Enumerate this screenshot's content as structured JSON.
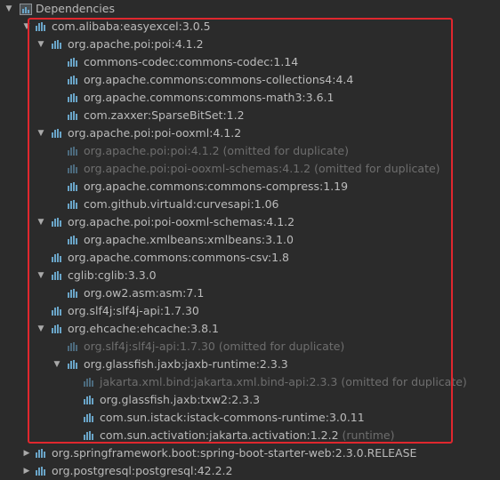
{
  "root": {
    "label": "Dependencies"
  },
  "colors": {
    "highlight": "#e0272e",
    "icon": "#6aa5c8",
    "text": "#bbbbbb",
    "dim": "#6e6e6e"
  },
  "tree": [
    {
      "label": "com.alibaba:easyexcel:3.0.5",
      "suffix": "",
      "level": 1,
      "expand": "open",
      "dim": false
    },
    {
      "label": "org.apache.poi:poi:4.1.2",
      "suffix": "",
      "level": 2,
      "expand": "open",
      "dim": false
    },
    {
      "label": "commons-codec:commons-codec:1.14",
      "suffix": "",
      "level": 3,
      "expand": "none",
      "dim": false
    },
    {
      "label": "org.apache.commons:commons-collections4:4.4",
      "suffix": "",
      "level": 3,
      "expand": "none",
      "dim": false
    },
    {
      "label": "org.apache.commons:commons-math3:3.6.1",
      "suffix": "",
      "level": 3,
      "expand": "none",
      "dim": false
    },
    {
      "label": "com.zaxxer:SparseBitSet:1.2",
      "suffix": "",
      "level": 3,
      "expand": "none",
      "dim": false
    },
    {
      "label": "org.apache.poi:poi-ooxml:4.1.2",
      "suffix": "",
      "level": 2,
      "expand": "open",
      "dim": false
    },
    {
      "label": "org.apache.poi:poi:4.1.2",
      "suffix": " (omitted for duplicate)",
      "level": 3,
      "expand": "none",
      "dim": true
    },
    {
      "label": "org.apache.poi:poi-ooxml-schemas:4.1.2",
      "suffix": " (omitted for duplicate)",
      "level": 3,
      "expand": "none",
      "dim": true
    },
    {
      "label": "org.apache.commons:commons-compress:1.19",
      "suffix": "",
      "level": 3,
      "expand": "none",
      "dim": false
    },
    {
      "label": "com.github.virtuald:curvesapi:1.06",
      "suffix": "",
      "level": 3,
      "expand": "none",
      "dim": false
    },
    {
      "label": "org.apache.poi:poi-ooxml-schemas:4.1.2",
      "suffix": "",
      "level": 2,
      "expand": "open",
      "dim": false
    },
    {
      "label": "org.apache.xmlbeans:xmlbeans:3.1.0",
      "suffix": "",
      "level": 3,
      "expand": "none",
      "dim": false
    },
    {
      "label": "org.apache.commons:commons-csv:1.8",
      "suffix": "",
      "level": 2,
      "expand": "none",
      "dim": false
    },
    {
      "label": "cglib:cglib:3.3.0",
      "suffix": "",
      "level": 2,
      "expand": "open",
      "dim": false
    },
    {
      "label": "org.ow2.asm:asm:7.1",
      "suffix": "",
      "level": 3,
      "expand": "none",
      "dim": false
    },
    {
      "label": "org.slf4j:slf4j-api:1.7.30",
      "suffix": "",
      "level": 2,
      "expand": "none",
      "dim": false
    },
    {
      "label": "org.ehcache:ehcache:3.8.1",
      "suffix": "",
      "level": 2,
      "expand": "open",
      "dim": false
    },
    {
      "label": "org.slf4j:slf4j-api:1.7.30",
      "suffix": " (omitted for duplicate)",
      "level": 3,
      "expand": "none",
      "dim": true
    },
    {
      "label": "org.glassfish.jaxb:jaxb-runtime:2.3.3",
      "suffix": "",
      "level": 3,
      "expand": "open",
      "dim": false
    },
    {
      "label": "jakarta.xml.bind:jakarta.xml.bind-api:2.3.3",
      "suffix": " (omitted for duplicate)",
      "level": 4,
      "expand": "none",
      "dim": true
    },
    {
      "label": "org.glassfish.jaxb:txw2:2.3.3",
      "suffix": "",
      "level": 4,
      "expand": "none",
      "dim": false
    },
    {
      "label": "com.sun.istack:istack-commons-runtime:3.0.11",
      "suffix": "",
      "level": 4,
      "expand": "none",
      "dim": false
    },
    {
      "label": "com.sun.activation:jakarta.activation:1.2.2",
      "suffix": " (runtime)",
      "level": 4,
      "expand": "none",
      "dim": false
    },
    {
      "label": "org.springframework.boot:spring-boot-starter-web:2.3.0.RELEASE",
      "suffix": "",
      "level": 1,
      "expand": "closed",
      "dim": false
    },
    {
      "label": "org.postgresql:postgresql:42.2.2",
      "suffix": "",
      "level": 1,
      "expand": "closed",
      "dim": false
    }
  ]
}
